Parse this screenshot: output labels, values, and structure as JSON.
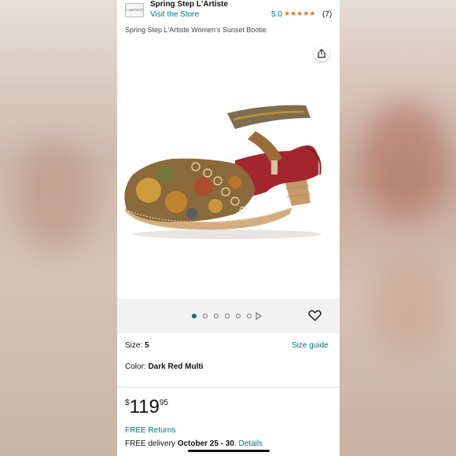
{
  "store": {
    "logo_text": "L'ARTISTE",
    "name": "Spring Step L'Artiste",
    "visit_label": "Visit the Store",
    "rating": "5.0",
    "stars": "★★★★★",
    "review_count": "(7)"
  },
  "product": {
    "title": "Spring Step L'Artiste Women's Sunset Bootie",
    "image_count": 6,
    "active_image_index": 0
  },
  "size": {
    "label": "Size: ",
    "value": "5",
    "guide_label": "Size guide"
  },
  "color": {
    "label": "Color: ",
    "value": "Dark Red Multi"
  },
  "price": {
    "currency": "$",
    "whole": "119",
    "fraction": "95"
  },
  "shipping": {
    "returns_label": "FREE Returns",
    "delivery_prefix": "FREE delivery ",
    "delivery_date": "October 25 - 30",
    "delivery_separator": ". ",
    "details_label": "Details"
  },
  "icons": {
    "share": "share-icon",
    "heart": "heart-icon",
    "play": "play-icon"
  },
  "colors": {
    "link": "#007185",
    "star": "#de7921",
    "text": "#111111"
  }
}
